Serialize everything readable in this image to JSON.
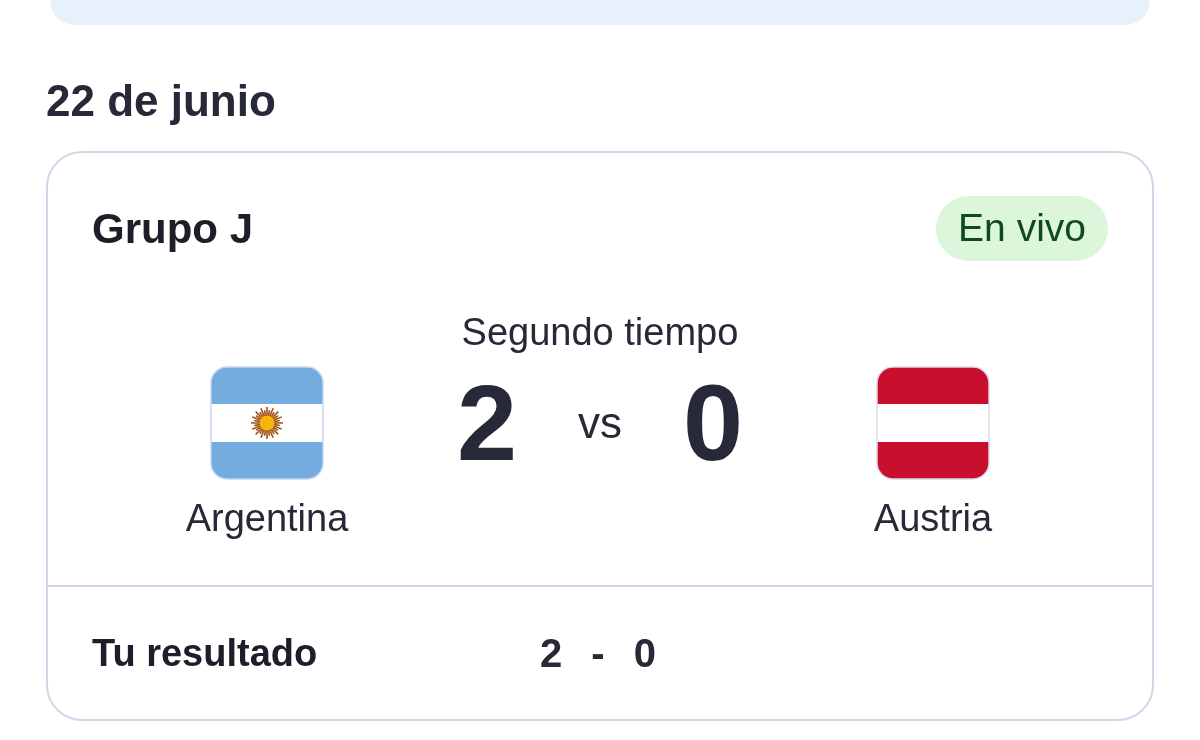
{
  "date_heading": "22 de junio",
  "match": {
    "group": "Grupo J",
    "status": {
      "label": "En vivo",
      "kind": "live"
    },
    "period": "Segundo tiempo",
    "separator": "vs",
    "teams": [
      {
        "name": "Argentina",
        "score": "2",
        "kind": "argentina"
      },
      {
        "name": "Austria",
        "score": "0",
        "kind": "austria"
      }
    ],
    "your_result": {
      "label": "Tu resultado",
      "value": "2 - 0"
    }
  }
}
